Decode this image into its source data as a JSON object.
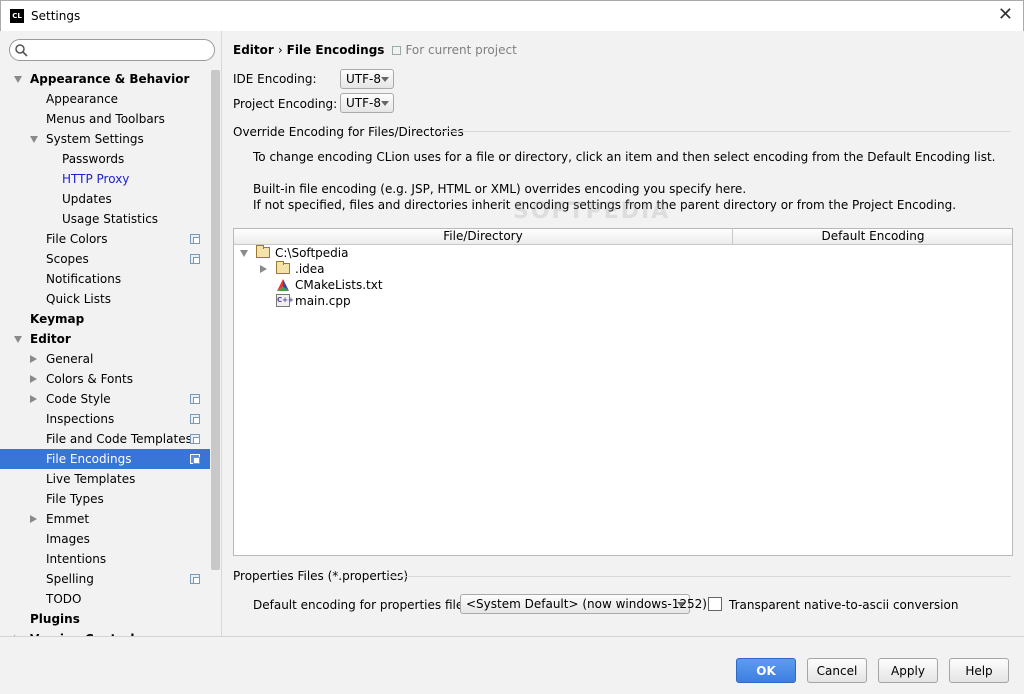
{
  "window": {
    "app_icon_text": "CL",
    "title": "Settings"
  },
  "search": {
    "value": ""
  },
  "sidebar": {
    "items": [
      {
        "label": "Appearance & Behavior",
        "level": 0,
        "bold": true,
        "arrow": "down"
      },
      {
        "label": "Appearance",
        "level": 1
      },
      {
        "label": "Menus and Toolbars",
        "level": 1
      },
      {
        "label": "System Settings",
        "level": 1,
        "arrow": "down"
      },
      {
        "label": "Passwords",
        "level": 2
      },
      {
        "label": "HTTP Proxy",
        "level": 2,
        "link": true
      },
      {
        "label": "Updates",
        "level": 2
      },
      {
        "label": "Usage Statistics",
        "level": 2
      },
      {
        "label": "File Colors",
        "level": 1,
        "copy": true
      },
      {
        "label": "Scopes",
        "level": 1,
        "copy": true
      },
      {
        "label": "Notifications",
        "level": 1
      },
      {
        "label": "Quick Lists",
        "level": 1
      },
      {
        "label": "Keymap",
        "level": 0,
        "bold": true
      },
      {
        "label": "Editor",
        "level": 0,
        "bold": true,
        "arrow": "down"
      },
      {
        "label": "General",
        "level": 1,
        "arrow": "right"
      },
      {
        "label": "Colors & Fonts",
        "level": 1,
        "arrow": "right"
      },
      {
        "label": "Code Style",
        "level": 1,
        "arrow": "right",
        "copy": true
      },
      {
        "label": "Inspections",
        "level": 1,
        "copy": true
      },
      {
        "label": "File and Code Templates",
        "level": 1,
        "copy": true
      },
      {
        "label": "File Encodings",
        "level": 1,
        "copy": true,
        "selected": true
      },
      {
        "label": "Live Templates",
        "level": 1
      },
      {
        "label": "File Types",
        "level": 1
      },
      {
        "label": "Emmet",
        "level": 1,
        "arrow": "right"
      },
      {
        "label": "Images",
        "level": 1
      },
      {
        "label": "Intentions",
        "level": 1
      },
      {
        "label": "Spelling",
        "level": 1,
        "copy": true
      },
      {
        "label": "TODO",
        "level": 1
      },
      {
        "label": "Plugins",
        "level": 0,
        "bold": true
      },
      {
        "label": "Version Control",
        "level": 0,
        "bold": true,
        "arrow": "right"
      }
    ]
  },
  "breadcrumb": {
    "parent": "Editor",
    "separator": "›",
    "current": "File Encodings",
    "scope": "For current project"
  },
  "encodings": {
    "ide_label": "IDE Encoding:",
    "ide_value": "UTF-8",
    "project_label": "Project Encoding:",
    "project_value": "UTF-8"
  },
  "override": {
    "title": "Override Encoding for Files/Directories",
    "line1": "To change encoding CLion uses for a file or directory, click an item and then select encoding from the Default Encoding list.",
    "line2": "Built-in file encoding (e.g. JSP, HTML or XML) overrides encoding you specify here.",
    "line3": "If not specified, files and directories inherit encoding settings from the parent directory or from the Project Encoding.",
    "columns": [
      "File/Directory",
      "Default Encoding"
    ],
    "rows": [
      {
        "name": "C:\\Softpedia",
        "icon": "folder-icon",
        "indent": 0,
        "arrow": "down"
      },
      {
        "name": ".idea",
        "icon": "folder-icon",
        "indent": 1,
        "arrow": "right"
      },
      {
        "name": "CMakeLists.txt",
        "icon": "cmake-icon",
        "indent": 1
      },
      {
        "name": "main.cpp",
        "icon": "cpp-icon",
        "indent": 1,
        "icon_text": "C++"
      }
    ]
  },
  "properties": {
    "title": "Properties Files (*.properties)",
    "default_label": "Default encoding for properties files:",
    "default_value": "<System Default> (now windows-1252)",
    "transparent_label": "Transparent native-to-ascii conversion",
    "transparent_checked": false
  },
  "watermark": "SOFTPEDIA",
  "buttons": {
    "ok": "OK",
    "cancel": "Cancel",
    "apply": "Apply",
    "help": "Help"
  },
  "colors": {
    "selection": "#3875d7",
    "link": "#2020d0",
    "primary_button": "#3d7ee0"
  }
}
